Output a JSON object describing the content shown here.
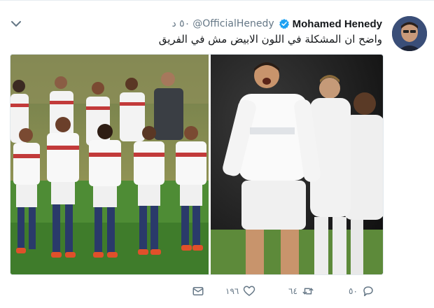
{
  "tweet": {
    "author_name": "Mohamed Henedy",
    "verified": true,
    "handle": "@OfficialHenedy",
    "timestamp": "٥٠ د",
    "text": "واضح ان المشكلة في اللون الابيض مش في الفريق",
    "media": {
      "left_image": "zamalek-team-photo",
      "right_image": "real-madrid-celebration"
    },
    "actions": {
      "reply_count": "٥٠",
      "retweet_count": "٦٤",
      "like_count": "١٩٦"
    },
    "colors": {
      "verified_blue": "#1da1f2",
      "secondary_text": "#657786",
      "primary_text": "#14171a"
    },
    "icons": {
      "menu": "chevron-down-icon",
      "verified": "verified-badge-icon",
      "reply": "reply-icon",
      "retweet": "retweet-icon",
      "like": "heart-icon",
      "message": "envelope-icon"
    }
  }
}
